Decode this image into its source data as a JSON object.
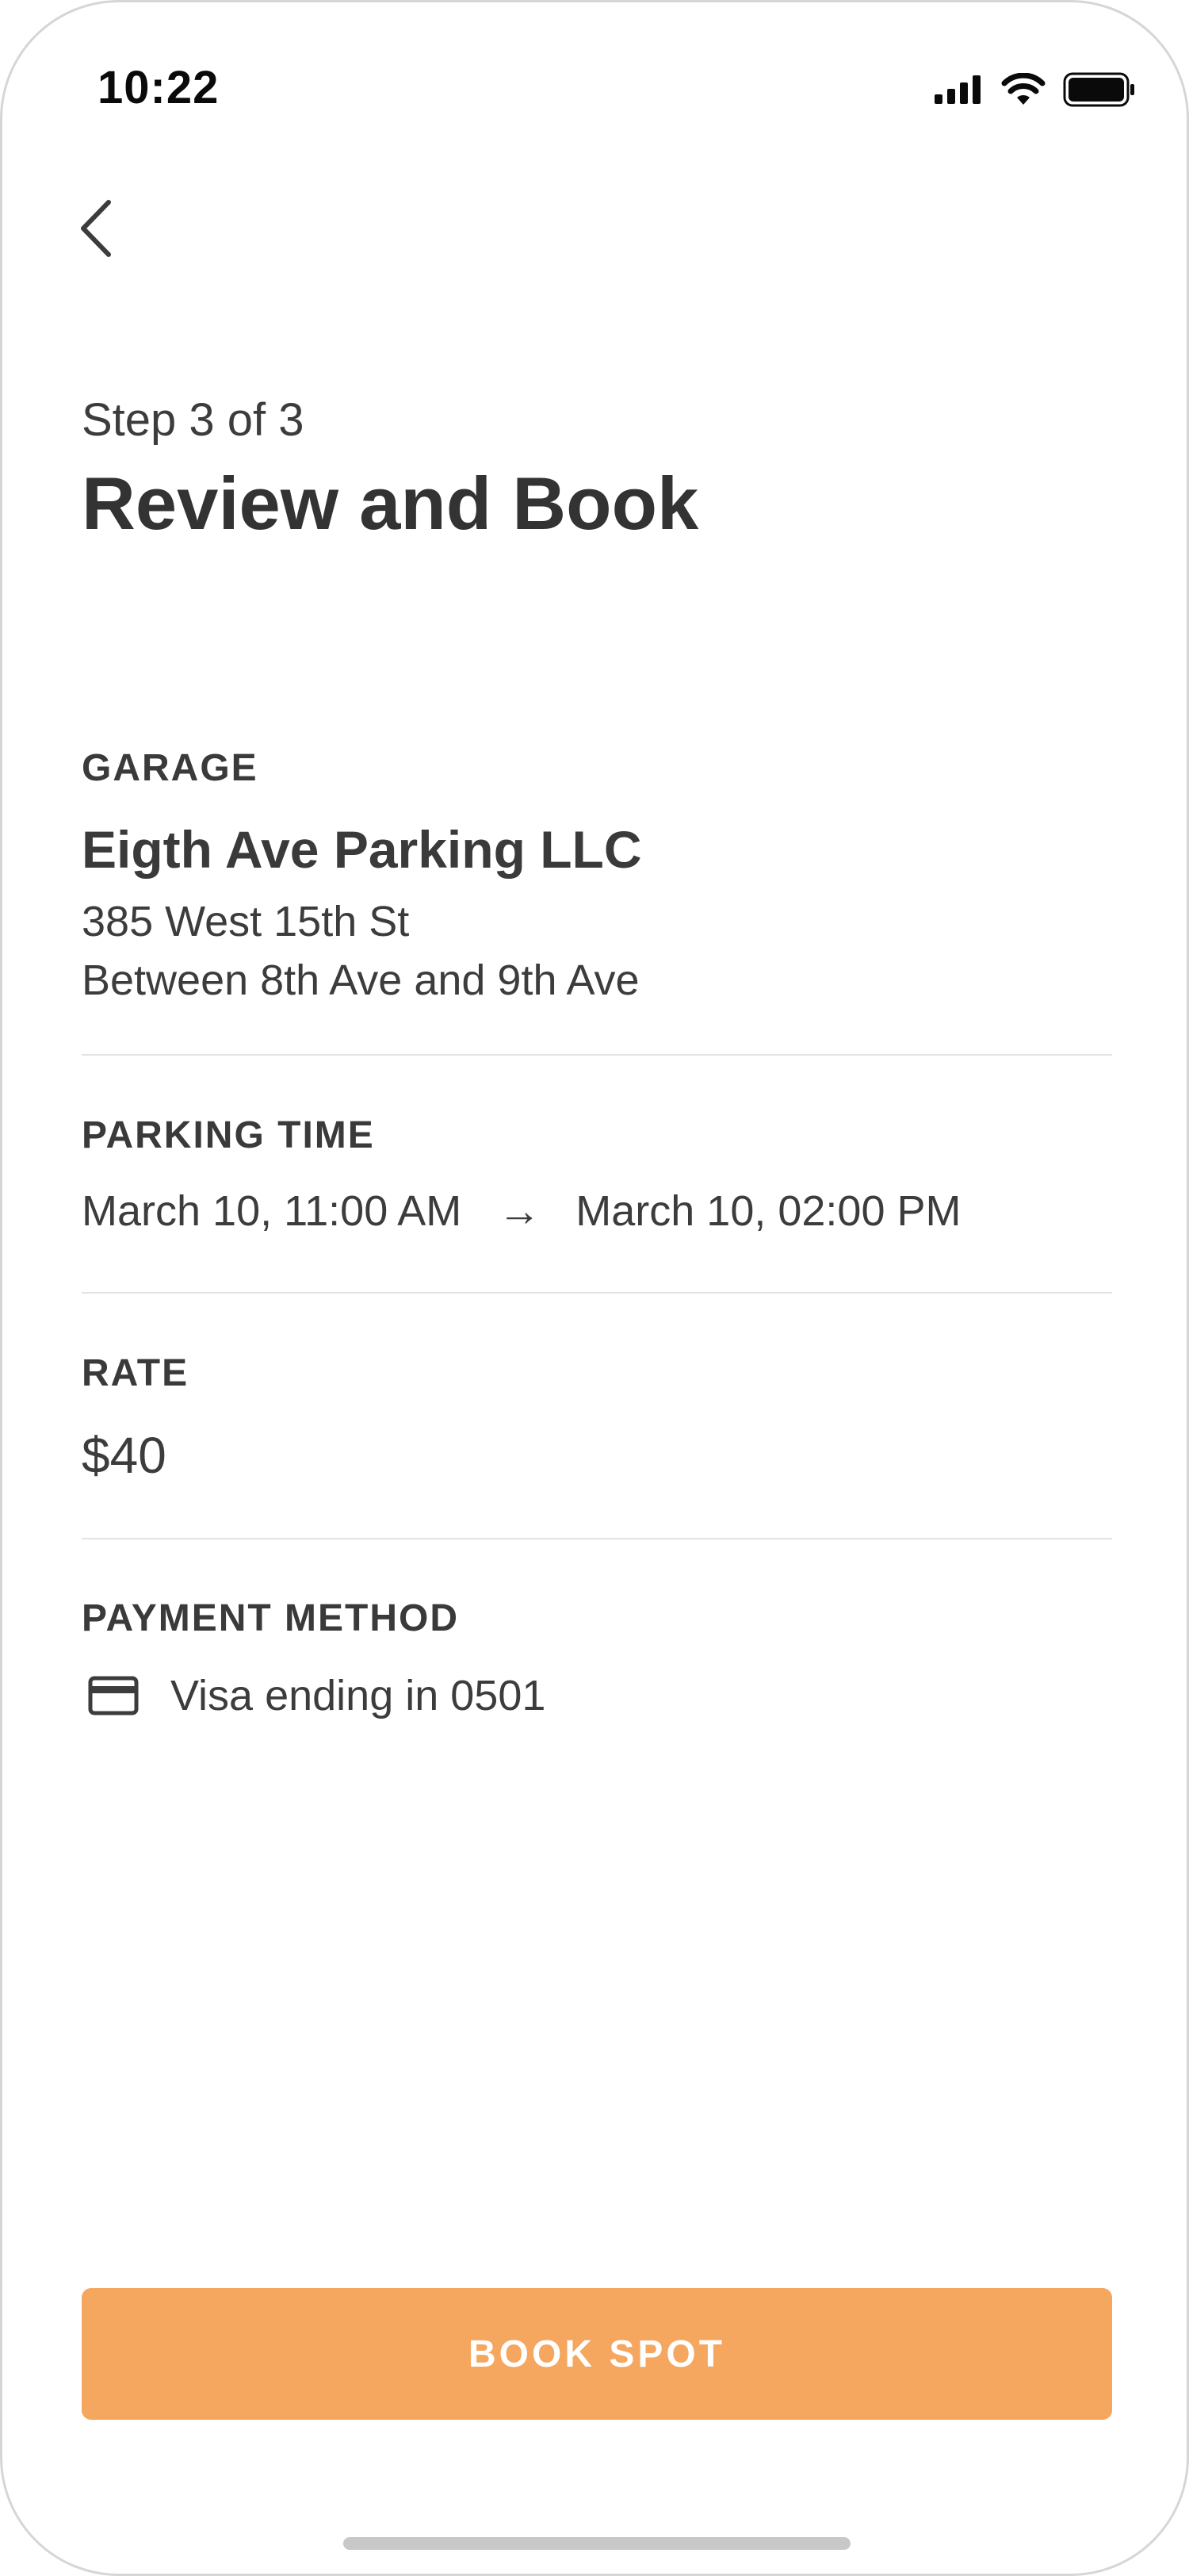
{
  "status_bar": {
    "time": "10:22",
    "icons": [
      "cellular-signal-icon",
      "wifi-icon",
      "battery-icon"
    ]
  },
  "header": {
    "back_icon": "chevron-left-icon",
    "step": "Step 3 of 3",
    "title": "Review and Book"
  },
  "garage": {
    "label": "GARAGE",
    "name": "Eigth Ave Parking LLC",
    "address_line1": "385 West 15th St",
    "address_line2": "Between 8th Ave and 9th Ave"
  },
  "parking_time": {
    "label": "PARKING TIME",
    "start": "March 10, 11:00 AM",
    "arrow": "→",
    "end": "March 10, 02:00 PM"
  },
  "rate": {
    "label": "RATE",
    "value": "$40"
  },
  "payment": {
    "label": "PAYMENT METHOD",
    "icon": "credit-card-icon",
    "method": "Visa ending in 0501"
  },
  "actions": {
    "book_label": "BOOK SPOT"
  },
  "colors": {
    "accent": "#f5a65f",
    "text": "#3c3c3c",
    "divider": "#e3e3e3"
  }
}
